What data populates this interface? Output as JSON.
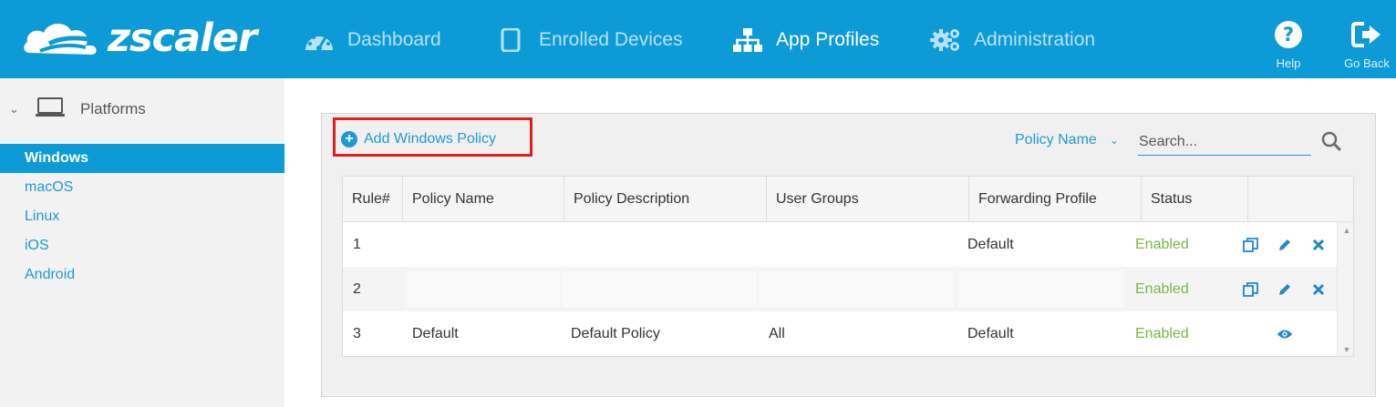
{
  "app": {
    "logo_text": "zscaler",
    "brand_color": "#0c9bd6"
  },
  "nav": [
    {
      "label": "Dashboard",
      "icon": "dashboard-gauge-icon",
      "active": false
    },
    {
      "label": "Enrolled Devices",
      "icon": "tablet-icon",
      "active": false
    },
    {
      "label": "App Profiles",
      "icon": "sitemap-icon",
      "active": true
    },
    {
      "label": "Administration",
      "icon": "gears-icon",
      "active": false
    }
  ],
  "top_actions": {
    "help_label": "Help",
    "back_label": "Go Back"
  },
  "sidebar": {
    "section_label": "Platforms",
    "items": [
      {
        "label": "Windows",
        "active": true
      },
      {
        "label": "macOS",
        "active": false
      },
      {
        "label": "Linux",
        "active": false
      },
      {
        "label": "iOS",
        "active": false
      },
      {
        "label": "Android",
        "active": false
      }
    ]
  },
  "toolbar": {
    "add_label": "Add Windows Policy",
    "filter_label": "Policy Name",
    "search_placeholder": "Search..."
  },
  "table": {
    "columns": [
      "Rule#",
      "Policy Name",
      "Policy Description",
      "User Groups",
      "Forwarding Profile",
      "Status"
    ],
    "rows": [
      {
        "rule": "1",
        "name": "",
        "description": "",
        "groups": "",
        "forwarding": "Default",
        "status": "Enabled",
        "actions": [
          "copy-icon",
          "edit-pencil-icon",
          "delete-x-icon"
        ]
      },
      {
        "rule": "2",
        "name": "",
        "description": "",
        "groups": "",
        "forwarding": "",
        "status": "Enabled",
        "actions": [
          "copy-icon",
          "edit-pencil-icon",
          "delete-x-icon"
        ]
      },
      {
        "rule": "3",
        "name": "Default",
        "description": "Default Policy",
        "groups": "All",
        "forwarding": "Default",
        "status": "Enabled",
        "actions": [
          "view-eye-icon"
        ]
      }
    ],
    "status_color": "#7ab648"
  }
}
